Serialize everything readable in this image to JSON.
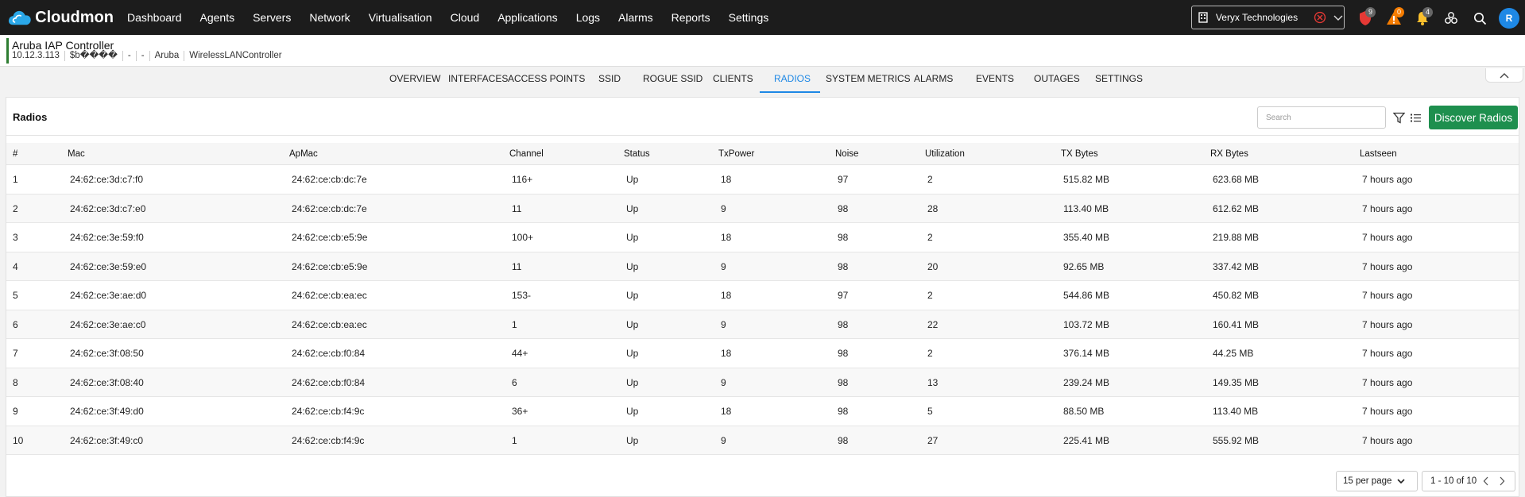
{
  "app": {
    "name": "Cloudmon",
    "menu": [
      "Dashboard",
      "Agents",
      "Servers",
      "Network",
      "Virtualisation",
      "Cloud",
      "Applications",
      "Logs",
      "Alarms",
      "Reports",
      "Settings"
    ],
    "organization": "Veryx Technologies",
    "badges": {
      "security": "9",
      "warnings": "0",
      "notifications": "4"
    },
    "avatar_initial": "R",
    "colors": {
      "accent": "#1e88e5",
      "primary_button": "#1e8f4e",
      "topbar": "#1c1c1c"
    }
  },
  "device": {
    "title": "Aruba IAP Controller",
    "meta": [
      "10.12.3.113",
      "$b����",
      "-",
      "-",
      "Aruba",
      "WirelessLANController"
    ]
  },
  "tabs": [
    "OVERVIEW",
    "INTERFACES",
    "ACCESS POINTS",
    "SSID",
    "ROGUE SSID",
    "CLIENTS",
    "RADIOS",
    "SYSTEM METRICS",
    "ALARMS",
    "EVENTS",
    "OUTAGES",
    "SETTINGS"
  ],
  "active_tab": "RADIOS",
  "panel": {
    "title": "Radios",
    "search_placeholder": "Search",
    "discover_label": "Discover Radios"
  },
  "table": {
    "columns": [
      "#",
      "Mac",
      "ApMac",
      "Channel",
      "Status",
      "TxPower",
      "Noise",
      "Utilization",
      "TX Bytes",
      "RX Bytes",
      "Lastseen"
    ],
    "rows": [
      [
        "1",
        "24:62:ce:3d:c7:f0",
        "24:62:ce:cb:dc:7e",
        "116+",
        "Up",
        "18",
        "97",
        "2",
        "515.82 MB",
        "623.68 MB",
        "7 hours ago"
      ],
      [
        "2",
        "24:62:ce:3d:c7:e0",
        "24:62:ce:cb:dc:7e",
        "11",
        "Up",
        "9",
        "98",
        "28",
        "113.40 MB",
        "612.62 MB",
        "7 hours ago"
      ],
      [
        "3",
        "24:62:ce:3e:59:f0",
        "24:62:ce:cb:e5:9e",
        "100+",
        "Up",
        "18",
        "98",
        "2",
        "355.40 MB",
        "219.88 MB",
        "7 hours ago"
      ],
      [
        "4",
        "24:62:ce:3e:59:e0",
        "24:62:ce:cb:e5:9e",
        "11",
        "Up",
        "9",
        "98",
        "20",
        "92.65 MB",
        "337.42 MB",
        "7 hours ago"
      ],
      [
        "5",
        "24:62:ce:3e:ae:d0",
        "24:62:ce:cb:ea:ec",
        "153-",
        "Up",
        "18",
        "97",
        "2",
        "544.86 MB",
        "450.82 MB",
        "7 hours ago"
      ],
      [
        "6",
        "24:62:ce:3e:ae:c0",
        "24:62:ce:cb:ea:ec",
        "1",
        "Up",
        "9",
        "98",
        "22",
        "103.72 MB",
        "160.41 MB",
        "7 hours ago"
      ],
      [
        "7",
        "24:62:ce:3f:08:50",
        "24:62:ce:cb:f0:84",
        "44+",
        "Up",
        "18",
        "98",
        "2",
        "376.14 MB",
        "44.25 MB",
        "7 hours ago"
      ],
      [
        "8",
        "24:62:ce:3f:08:40",
        "24:62:ce:cb:f0:84",
        "6",
        "Up",
        "9",
        "98",
        "13",
        "239.24 MB",
        "149.35 MB",
        "7 hours ago"
      ],
      [
        "9",
        "24:62:ce:3f:49:d0",
        "24:62:ce:cb:f4:9c",
        "36+",
        "Up",
        "18",
        "98",
        "5",
        "88.50 MB",
        "113.40 MB",
        "7 hours ago"
      ],
      [
        "10",
        "24:62:ce:3f:49:c0",
        "24:62:ce:cb:f4:9c",
        "1",
        "Up",
        "9",
        "98",
        "27",
        "225.41 MB",
        "555.92 MB",
        "7 hours ago"
      ]
    ]
  },
  "pagination": {
    "per_page": "15 per page",
    "range": "1 - 10 of 10"
  }
}
